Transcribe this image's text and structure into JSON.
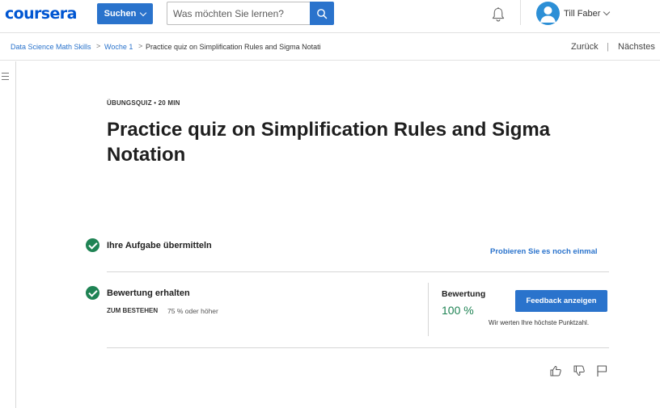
{
  "header": {
    "logo": "coursera",
    "search_menu_label": "Suchen",
    "search_placeholder": "Was möchten Sie lernen?",
    "search_icon": "magnifier-icon",
    "notifications_icon": "bell-icon",
    "user_name": "Till Faber"
  },
  "breadcrumb": {
    "items": [
      "Data Science Math Skills",
      "Woche 1",
      "Practice quiz on Simplification Rules and Sigma Notati"
    ],
    "separator": ">"
  },
  "nav": {
    "prev_label": "Zurück",
    "separator": "|",
    "next_label": "Nächstes"
  },
  "quiz": {
    "eyebrow": "ÜBUNGSQUIZ • 20 MIN",
    "title": "Practice quiz on Simplification Rules and Sigma Notation",
    "submit_step": {
      "label": "Ihre Aufgabe übermitteln",
      "retry_label": "Probieren Sie es noch einmal"
    },
    "grade_step": {
      "label": "Bewertung erhalten",
      "pass_label": "ZUM BESTEHEN",
      "pass_value": "75 % oder höher",
      "grade_label": "Bewertung",
      "grade_value": "100 %",
      "feedback_button": "Feedback anzeigen",
      "grade_note": "Wir werten Ihre höchste Punktzahl."
    }
  },
  "colors": {
    "brand": "#0056d2",
    "primary_button": "#2a73cc",
    "success": "#1f8354"
  }
}
